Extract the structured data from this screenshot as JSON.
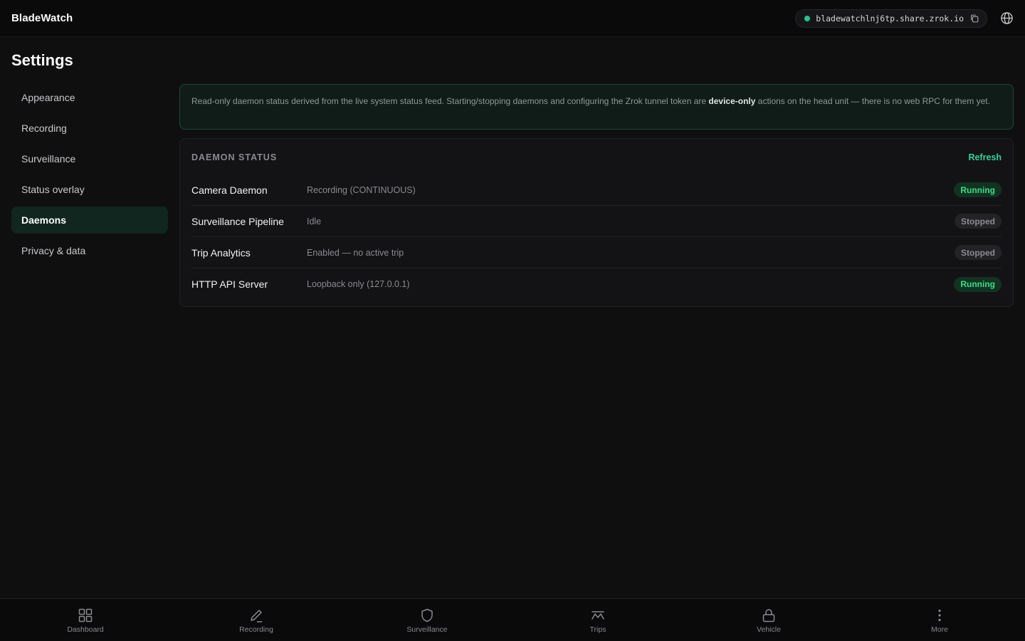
{
  "app": {
    "name": "BladeWatch"
  },
  "header": {
    "share_url": "bladewatchlnj6tp.share.zrok.io",
    "status_color": "#22c58b",
    "copy_icon": "copy-icon",
    "globe_icon": "globe-icon"
  },
  "page": {
    "title": "Settings"
  },
  "sidebar": {
    "items": [
      {
        "label": "Appearance",
        "active": false
      },
      {
        "label": "Recording",
        "active": false
      },
      {
        "label": "Surveillance",
        "active": false
      },
      {
        "label": "Status overlay",
        "active": false
      },
      {
        "label": "Daemons",
        "active": true
      },
      {
        "label": "Privacy & data",
        "active": false
      }
    ]
  },
  "notice": {
    "text_before": "Read-only daemon status derived from the live system status feed. Starting/stopping daemons and configuring the Zrok tunnel token are ",
    "text_bold": "device-only",
    "text_after": " actions on the head unit — there is no web RPC for them yet."
  },
  "daemons": {
    "title": "DAEMON STATUS",
    "refresh_label": "Refresh",
    "rows": [
      {
        "name": "Camera Daemon",
        "detail": "Recording (CONTINUOUS)",
        "status": "Running"
      },
      {
        "name": "Surveillance Pipeline",
        "detail": "Idle",
        "status": "Stopped"
      },
      {
        "name": "Trip Analytics",
        "detail": "Enabled — no active trip",
        "status": "Stopped"
      },
      {
        "name": "HTTP API Server",
        "detail": "Loopback only (127.0.0.1)",
        "status": "Running"
      }
    ]
  },
  "colors": {
    "accent": "#2fd39a",
    "running": "#3ddc84",
    "stopped": "#8a8a90"
  },
  "bottom_nav": {
    "items": [
      {
        "label": "Dashboard",
        "icon": "grid-icon"
      },
      {
        "label": "Recording",
        "icon": "pen-icon"
      },
      {
        "label": "Surveillance",
        "icon": "shield-icon"
      },
      {
        "label": "Trips",
        "icon": "route-icon"
      },
      {
        "label": "Vehicle",
        "icon": "lock-icon"
      },
      {
        "label": "More",
        "icon": "more-vertical-icon"
      }
    ]
  }
}
